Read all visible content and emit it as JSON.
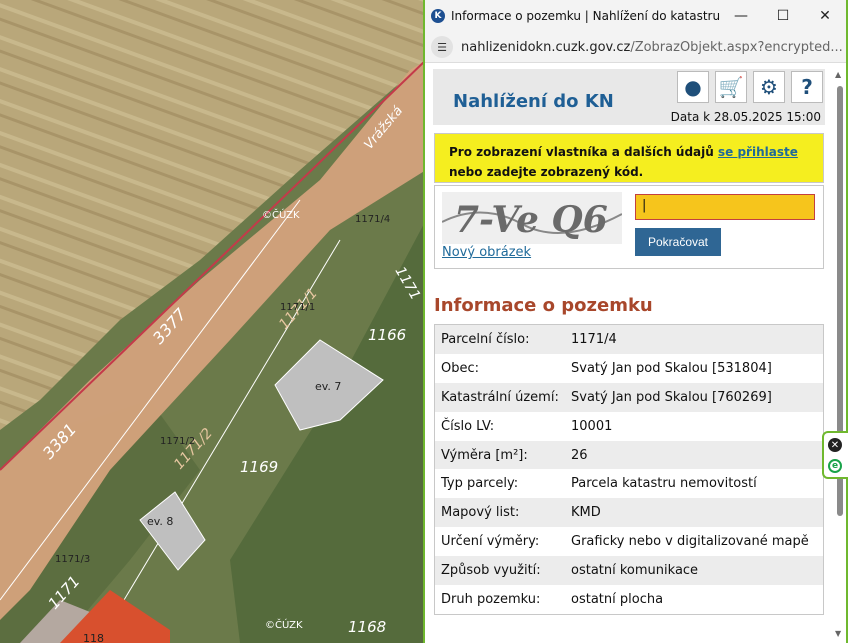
{
  "window": {
    "title": "Informace o pozemku | Nahlížení do katastru n...",
    "url_domain": "nahlizenidokn.cuzk.gov.cz",
    "url_path": "/ZobrazObjekt.aspx?encrypted..."
  },
  "header": {
    "brand": "Nahlížení do KN",
    "date": "Data k 28.05.2025 15:00"
  },
  "notice": {
    "text_before": "Pro zobrazení vlastníka a dalších údajů ",
    "link": "se přihlaste",
    "text_after": " nebo zadejte zobrazený kód."
  },
  "captcha": {
    "image_text": "7-Ve Q6",
    "new_image": "Nový obrázek",
    "input_value": "|",
    "submit": "Pokračovat"
  },
  "section_title": "Informace o pozemku",
  "rows": [
    {
      "k": "Parcelní číslo:",
      "v": "1171/4"
    },
    {
      "k": "Obec:",
      "v": "Svatý Jan pod Skalou [531804]"
    },
    {
      "k": "Katastrální území:",
      "v": "Svatý Jan pod Skalou [760269]"
    },
    {
      "k": "Číslo LV:",
      "v": "10001"
    },
    {
      "k": "Výměra [m²]:",
      "v": "26"
    },
    {
      "k": "Typ parcely:",
      "v": "Parcela katastru nemovitostí"
    },
    {
      "k": "Mapový list:",
      "v": "KMD"
    },
    {
      "k": "Určení výměry:",
      "v": "Graficky nebo v digitalizované mapě"
    },
    {
      "k": "Způsob využití:",
      "v": "ostatní komunikace"
    },
    {
      "k": "Druh pozemku:",
      "v": "ostatní plocha"
    }
  ],
  "map": {
    "road_name": "Vrážská",
    "labels": [
      "3377",
      "3381",
      "1171/4",
      "1171/1",
      "1171/1",
      "1171/2",
      "1171/2",
      "1171/3",
      "1171",
      "1171",
      "1166",
      "1169",
      "1168",
      "ev. 7",
      "ev. 8",
      "118"
    ],
    "watermark": "©ČÚZK"
  }
}
